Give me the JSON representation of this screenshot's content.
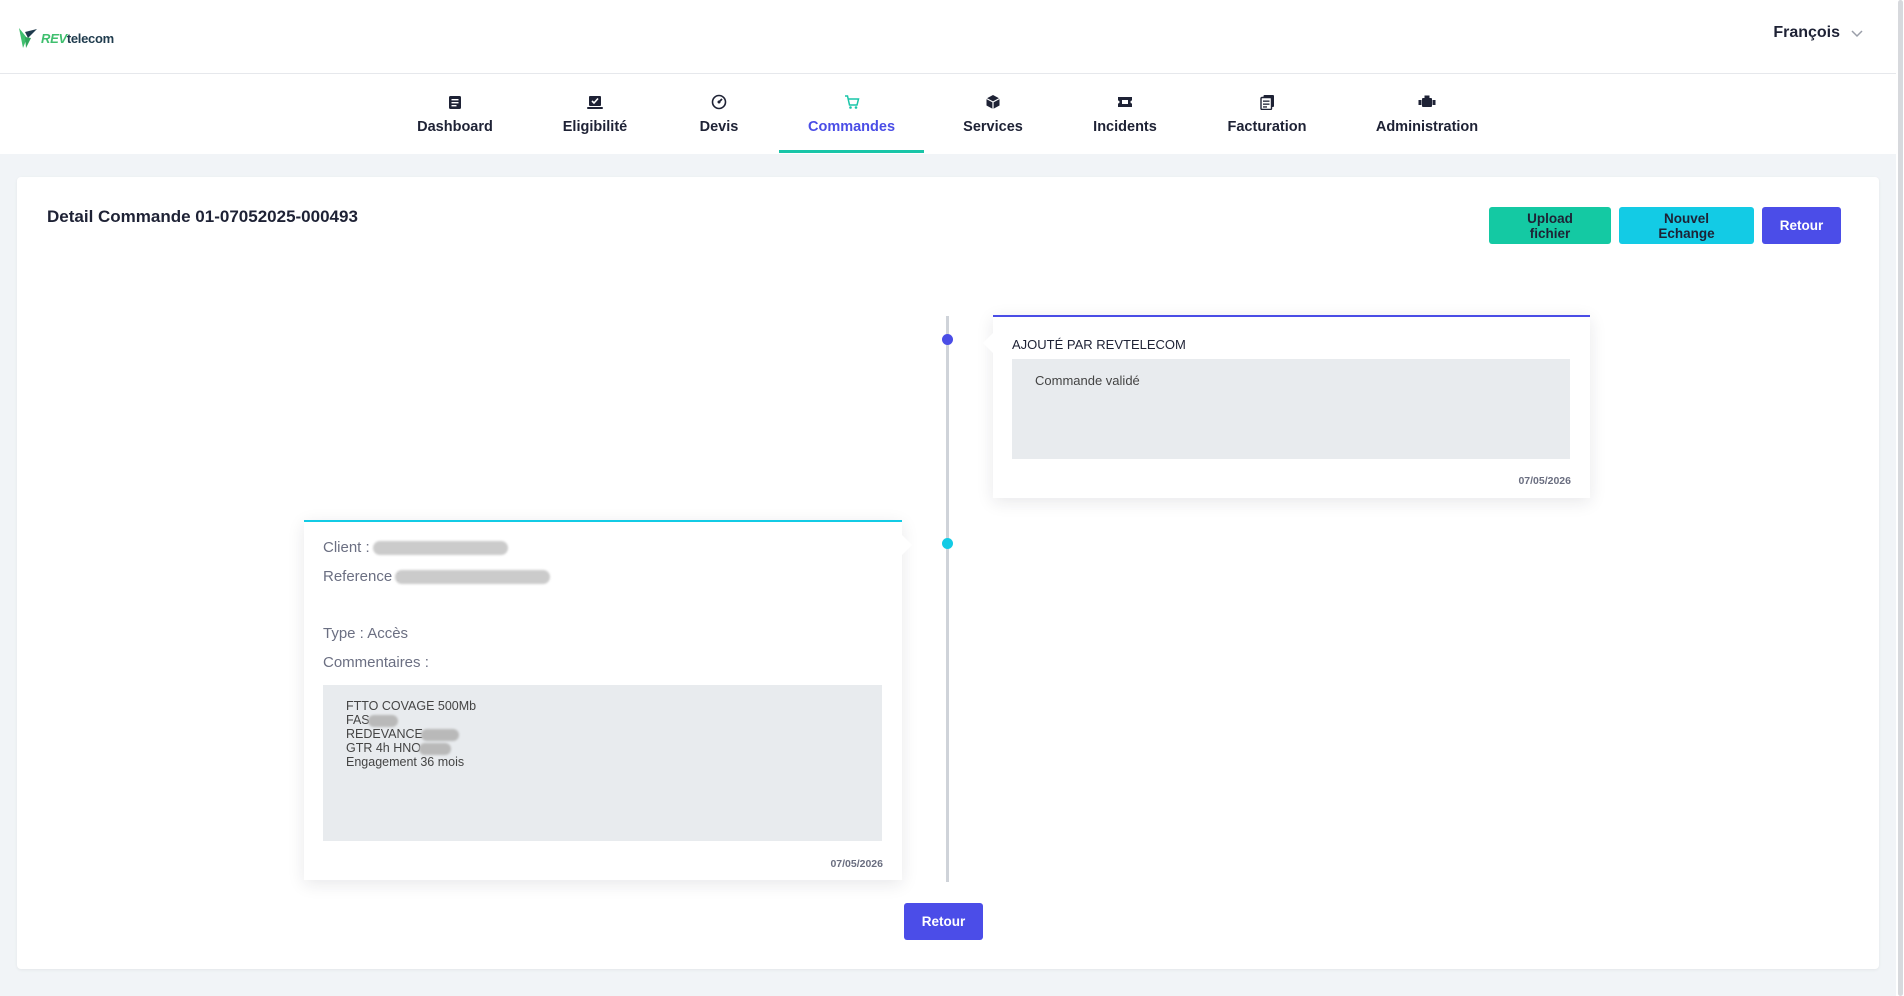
{
  "header": {
    "logo": {
      "part1": "REV",
      "part2": "telecom"
    },
    "user_name": "François"
  },
  "nav": {
    "items": [
      {
        "label": "Dashboard",
        "icon": "document-icon"
      },
      {
        "label": "Eligibilité",
        "icon": "laptop-check-icon"
      },
      {
        "label": "Devis",
        "icon": "gauge-icon"
      },
      {
        "label": "Commandes",
        "icon": "cart-icon",
        "active": true
      },
      {
        "label": "Services",
        "icon": "cube-icon"
      },
      {
        "label": "Incidents",
        "icon": "ticket-icon"
      },
      {
        "label": "Facturation",
        "icon": "invoice-icon"
      },
      {
        "label": "Administration",
        "icon": "engine-icon"
      }
    ]
  },
  "page": {
    "title": "Detail Commande 01-07052025-000493",
    "buttons": {
      "upload": "Upload fichier",
      "new_exchange": "Nouvel Echange",
      "back": "Retour"
    }
  },
  "timeline": {
    "entry1": {
      "author": "AJOUTÉ PAR REVTELECOM",
      "message": "Commande validé",
      "date": "07/05/2026"
    },
    "entry2": {
      "client_label": "Client :",
      "reference_label": "Reference :",
      "type_label": "Type : Accès",
      "comments_label": "Commentaires :",
      "comment_lines": [
        "FTTO COVAGE 500Mb",
        "FAS",
        "REDEVANCE",
        "GTR 4h HNO",
        "Engagement 36 mois"
      ],
      "date": "07/05/2026"
    }
  },
  "footer": {
    "back": "Retour"
  },
  "colors": {
    "primary": "#4b4de8",
    "green": "#14c9a3",
    "cyan": "#13cbe5",
    "background": "#f1f4f7"
  }
}
